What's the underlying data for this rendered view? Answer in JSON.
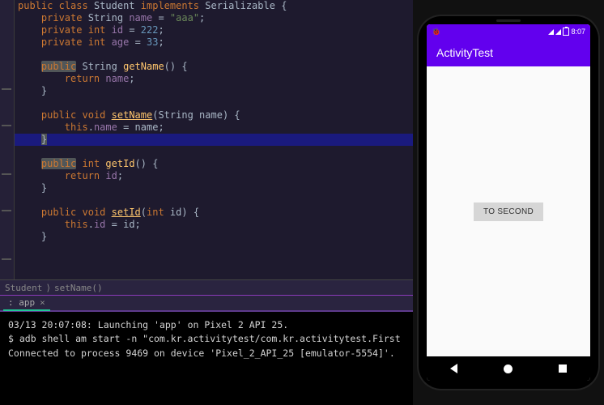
{
  "code": {
    "class_decl": {
      "public": "public",
      "class": "class",
      "name": "Student",
      "implements": "implements",
      "iface": "Serializable",
      "brace": "{"
    },
    "field1": {
      "access": "private",
      "type": "String",
      "name": "name",
      "eq": "=",
      "value": "\"aaa\"",
      "semi": ";"
    },
    "field2": {
      "access": "private",
      "type": "int",
      "name": "id",
      "eq": "=",
      "value": "222",
      "semi": ";"
    },
    "field3": {
      "access": "private",
      "type": "int",
      "name": "age",
      "eq": "=",
      "value": "33",
      "semi": ";"
    },
    "getName": {
      "access": "public",
      "rtype": "String",
      "name": "getName",
      "params": "()",
      "brace": "{",
      "ret": "return",
      "field": "name",
      "semi": ";",
      "close": "}"
    },
    "setName": {
      "access": "public",
      "rtype": "void",
      "name": "setName",
      "ptype": "String",
      "pname": "name",
      "brace": "{",
      "this": "this",
      "dot": ".",
      "field": "name",
      "eq": "=",
      "rhs": "name",
      "semi": ";",
      "close": "}"
    },
    "getId": {
      "access": "public",
      "rtype": "int",
      "name": "getId",
      "params": "()",
      "brace": "{",
      "ret": "return",
      "field": "id",
      "semi": ";",
      "close": "}"
    },
    "setId": {
      "access": "public",
      "rtype": "void",
      "name": "setId",
      "ptype": "int",
      "pname": "id",
      "brace": "{",
      "this": "this",
      "dot": ".",
      "field": "id",
      "eq": "=",
      "rhs": "id",
      "semi": ";",
      "close": "}"
    }
  },
  "breadcrumb": {
    "class": "Student",
    "sep": "⟩",
    "method": "setName()"
  },
  "tab": {
    "label": ": app",
    "close": "×"
  },
  "console": {
    "l1a": "03/13 20:07:08: Launching '",
    "l1b": "app",
    "l1c": "' on ",
    "l1d": "Pixel 2 API 25",
    "l1e": ".",
    "l2a": "$ adb shell am start -n \"com.kr.activitytest/com.kr.activitytest.First",
    "l3a": "Connected to process 9469 on device '",
    "l3b": "Pixel_2_API_25 [emulator-5554]",
    "l3c": "'."
  },
  "phone": {
    "status": {
      "time": "8:07",
      "bug": "🐞"
    },
    "app_title": "ActivityTest",
    "button": "TO SECOND"
  }
}
